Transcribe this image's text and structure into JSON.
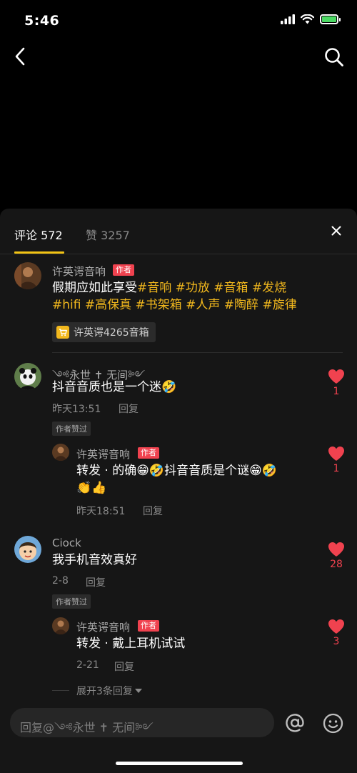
{
  "status": {
    "time": "5:46"
  },
  "tabs": {
    "comments": "评论 572",
    "likes": "赞 3257"
  },
  "author_post": {
    "name": "许英谔音响",
    "tag": "作者",
    "text_plain": "假期应如此享受",
    "hashtags_line1": "#音响 #功放 #音箱 #发烧",
    "hashtags_line2": "#hifi #高保真 #书架箱 #人声 #陶醉 #旋律",
    "product": "许英谔4265音箱"
  },
  "comments": [
    {
      "name": "༺永世 ✝ 无间༻",
      "text": "抖音音质也是一个迷🤣",
      "time": "昨天13:51",
      "reply": "回复",
      "badge": "作者赞过",
      "likes": "1",
      "reply_item": {
        "name": "许英谔音响",
        "tag": "作者",
        "text_line1": "转发 · 的确😁🤣抖音音质是个谜😁🤣",
        "text_line2": "👏👍",
        "time": "昨天18:51",
        "reply": "回复",
        "likes": "1"
      }
    },
    {
      "name": "Ciock",
      "text": "我手机音效真好",
      "time": "2-8",
      "reply": "回复",
      "badge": "作者赞过",
      "likes": "28",
      "reply_item": {
        "name": "许英谔音响",
        "tag": "作者",
        "text_line1": "转发 · 戴上耳机试试",
        "time": "2-21",
        "reply": "回复",
        "likes": "3"
      }
    }
  ],
  "expand": "展开3条回复",
  "input": {
    "placeholder": "回复@༺永世 ✝ 无间༻"
  },
  "icons": {
    "at": "at-icon",
    "emoji": "emoji-icon"
  },
  "colors": {
    "accent": "#f2c314",
    "like": "#f0424f",
    "hashtag": "#f2b81d"
  }
}
